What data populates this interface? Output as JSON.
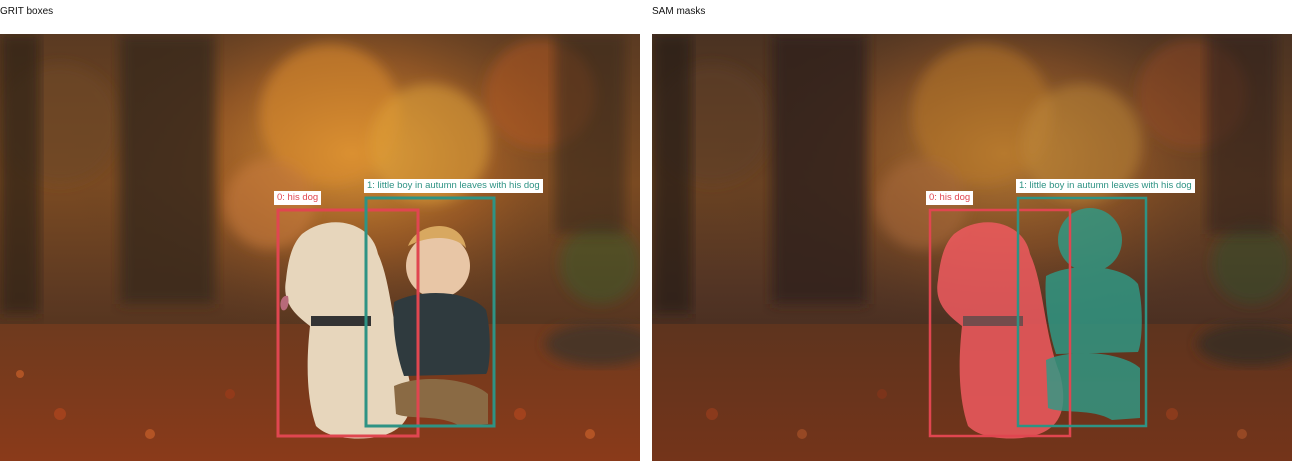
{
  "panels": {
    "left_title": "GRIT boxes",
    "right_title": "SAM masks"
  },
  "boxes": [
    {
      "label": "0: his dog",
      "color": "#e04650"
    },
    {
      "label": "1: little boy in autumn leaves with his dog",
      "color": "#2e9384"
    }
  ],
  "colors": {
    "dog_mask": "#ef5a5f",
    "boy_mask": "#2f9a86"
  }
}
